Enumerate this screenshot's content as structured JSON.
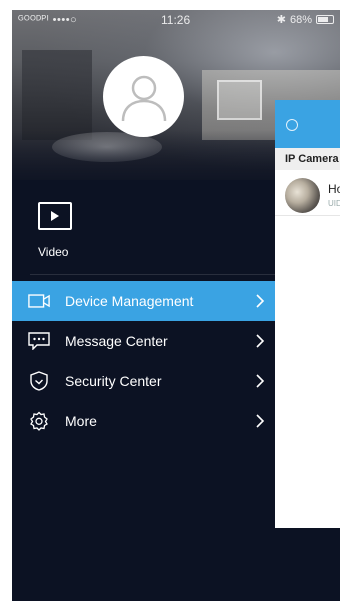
{
  "status_bar": {
    "carrier": "ᴳᴼᴼᴰᴾᴵ ••••○",
    "time": "11:26",
    "bluetooth": "✱",
    "battery_percent": "68%"
  },
  "drawer": {
    "video_label": "Video",
    "menu": [
      {
        "label": "Device Management",
        "icon": "camera-icon",
        "active": true
      },
      {
        "label": "Message Center",
        "icon": "message-icon",
        "active": false
      },
      {
        "label": "Security Center",
        "icon": "shield-icon",
        "active": false
      },
      {
        "label": "More",
        "icon": "gear-icon",
        "active": false
      }
    ]
  },
  "panel": {
    "section_title": "IP Camera",
    "device": {
      "title": "Ho",
      "subtitle": "UID"
    }
  },
  "colors": {
    "accent": "#3aa3e3",
    "drawer_bg": "#0c1223"
  }
}
